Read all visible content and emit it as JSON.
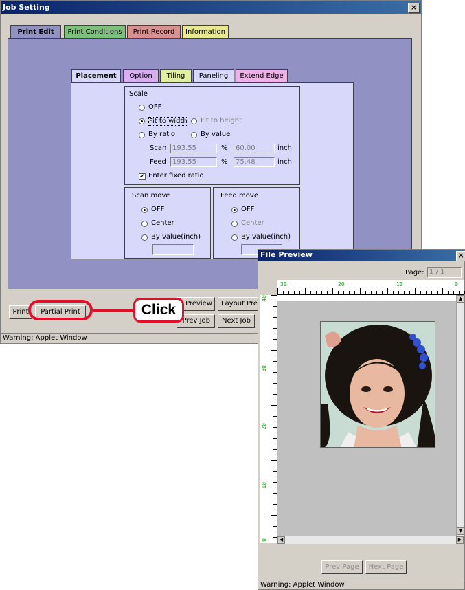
{
  "job_window": {
    "title": "Job Setting",
    "close": "×",
    "tabs": [
      "Print Edit",
      "Print Conditions",
      "Print Record",
      "Information"
    ],
    "sub_tabs": [
      "Placement",
      "Option",
      "Tiling",
      "Paneling",
      "Extend Edge"
    ],
    "scale": {
      "title": "Scale",
      "off": "OFF",
      "fit_width": "Fit to width",
      "fit_height": "Fit to height",
      "by_ratio": "By ratio",
      "by_value": "By value",
      "scan_label": "Scan",
      "scan_pct": "193.55",
      "scan_in": "60.00",
      "feed_label": "Feed",
      "feed_pct": "193.55",
      "feed_in": "75.48",
      "pct": "%",
      "inch": "inch",
      "fixed_ratio": "Enter fixed ratio"
    },
    "scan_move": {
      "title": "Scan move",
      "off": "OFF",
      "center": "Center",
      "by_value": "By value(inch)"
    },
    "feed_move": {
      "title": "Feed move",
      "off": "OFF",
      "center": "Center",
      "by_value": "By value(inch)"
    },
    "buttons": {
      "print": "Print",
      "partial_print": "Partial Print",
      "preview": "Preview",
      "layout_preview": "Layout Pre",
      "prev_job": "Prev Job",
      "next_job": "Next Job"
    },
    "status": "Warning: Applet Window"
  },
  "callout": {
    "text": "Click"
  },
  "preview_window": {
    "title": "File Preview",
    "close": "×",
    "page_label": "Page:",
    "page_value": "1 / 1",
    "top_ruler": [
      "30",
      "20",
      "10",
      "0"
    ],
    "left_ruler": [
      "40",
      "30",
      "20",
      "10",
      "0"
    ],
    "prev_page": "Prev Page",
    "next_page": "Next Page",
    "status": "Warning: Applet Window"
  }
}
